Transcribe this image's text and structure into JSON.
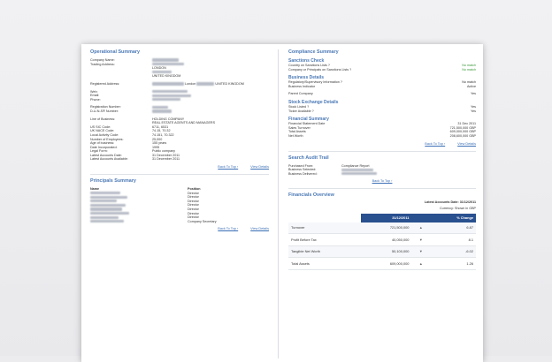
{
  "operational": {
    "title": "Operational Summary",
    "company_name_label": "Company Name:",
    "trading_address_label": "Trading Address:",
    "address_city": "LONDON",
    "address_country": "UNITED KINGDOM",
    "registered_label": "Registered Address:",
    "registered_city": "London",
    "registered_country": "UNITED KINGDOM",
    "web_label": "Web:",
    "email_label": "Email:",
    "phone_label": "Phone:",
    "registration_label": "Registration Number:",
    "duns_label": "D-U-N-S® Number:",
    "line_label": "Line of Business:",
    "line_value_1": "HOLDING COMPANY",
    "line_value_2": "REAL ESTATE AGENTS AND MANAGERS",
    "details": [
      {
        "label": "US SIC Code:",
        "value": "6711, 6531"
      },
      {
        "label": "UK NACE Code:",
        "value": "74.15, 70.32"
      },
      {
        "label": "Local Activity Code:",
        "value": "74.151, 70.322"
      },
      {
        "label": "Number of Employees:",
        "value": "25,000"
      },
      {
        "label": "Age of business:",
        "value": "155 years"
      },
      {
        "label": "Date Incorporated:",
        "value": "1995"
      },
      {
        "label": "Legal Form:",
        "value": "Public company"
      },
      {
        "label": "Latest Accounts Date:",
        "value": "31 December 2011"
      },
      {
        "label": "Latest Accounts Available:",
        "value": "31 December 2011"
      }
    ],
    "back_to_top": "Back To Top ›",
    "view_details": "View Details"
  },
  "principals": {
    "title": "Principals Summary",
    "col_name": "Name",
    "col_position": "Position",
    "positions": [
      "Director",
      "Director",
      "Director",
      "Director",
      "Director",
      "Director",
      "Director",
      "Company Secretary"
    ],
    "back_to_top": "Back To Top ›",
    "view_details": "View Details"
  },
  "compliance": {
    "title": "Compliance Summary",
    "sanctions_title": "Sanctions Check",
    "sanctions": [
      {
        "label": "Country on Sanctions Lists ?",
        "value": "No match"
      },
      {
        "label": "Company or Principals on Sanctions Lists ?",
        "value": "No match"
      }
    ],
    "business_title": "Business Details",
    "business": [
      {
        "label": "Regulatory/Supervisory Information ?",
        "value": "No match"
      },
      {
        "label": "Business Indicator",
        "value": "Active"
      }
    ],
    "parent_label": "Parent Company",
    "parent_value": "Yes",
    "stock_title": "Stock Exchange Details",
    "stock": [
      {
        "label": "Stock Listed ?",
        "value": "Yes"
      },
      {
        "label": "Ticker Available ?",
        "value": "Yes"
      }
    ],
    "financial_title": "Financial Summary",
    "financial": [
      {
        "label": "Financial Statement Date",
        "value": "31 Dec 2011"
      },
      {
        "label": "Sales Turnover",
        "value": "721,500,000 GBP"
      },
      {
        "label": "Total Assets",
        "value": "609,000,000 GBP"
      },
      {
        "label": "Net Worth",
        "value": "208,600,000 GBP"
      }
    ],
    "back_to_top": "Back To Top ›",
    "view_details": "View Details"
  },
  "audit": {
    "title": "Search Audit Trail",
    "rows": [
      {
        "label": "Purchased From:",
        "value": "Compliance Report"
      },
      {
        "label": "Business Selected:",
        "value": ""
      },
      {
        "label": "Business Delivered:",
        "value": ""
      }
    ],
    "back_to_top": "Back To Top ›"
  },
  "financials": {
    "title": "Financials Overview",
    "latest_accounts": "Latest Accounts Date: 31/12/2011",
    "currency": "Currency: Shown in GBP",
    "col_date": "31/12/2011",
    "col_change": "% Change",
    "rows": [
      {
        "label": "Turnover",
        "value": "721,500,000",
        "arrow": "▲",
        "change": "6.87"
      },
      {
        "label": "Profit Before Tax",
        "value": "40,050,000",
        "arrow": "▼",
        "change": "8.1"
      },
      {
        "label": "Tangible Net Worth",
        "value": "50,100,000",
        "arrow": "▼",
        "change": "-6.02"
      },
      {
        "label": "Total Assets",
        "value": "609,000,000",
        "arrow": "▲",
        "change": "1.26"
      }
    ]
  }
}
